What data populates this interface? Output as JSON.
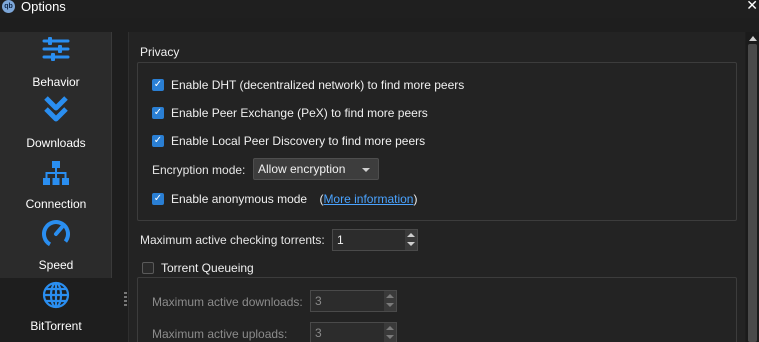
{
  "window": {
    "title": "Options",
    "app_icon_text": "qb"
  },
  "sidebar": {
    "items": [
      {
        "label": "Behavior",
        "icon": "sliders-icon"
      },
      {
        "label": "Downloads",
        "icon": "double-chevron-down-icon"
      },
      {
        "label": "Connection",
        "icon": "network-icon"
      },
      {
        "label": "Speed",
        "icon": "speedometer-icon"
      },
      {
        "label": "BitTorrent",
        "icon": "globe-icon",
        "selected": true
      }
    ]
  },
  "privacy": {
    "title": "Privacy",
    "dht_label": "Enable DHT (decentralized network) to find more peers",
    "dht_checked": true,
    "pex_label": "Enable Peer Exchange (PeX) to find more peers",
    "pex_checked": true,
    "lsd_label": "Enable Local Peer Discovery to find more peers",
    "lsd_checked": true,
    "encryption_label": "Encryption mode:",
    "encryption_value": "Allow encryption",
    "anonymous_label": "Enable anonymous mode",
    "anonymous_checked": true,
    "more_info_open": "(",
    "more_info_link": "More information",
    "more_info_close": ")"
  },
  "checking": {
    "label": "Maximum active checking torrents:",
    "value": "1"
  },
  "queueing": {
    "label": "Torrent Queueing",
    "checked": false,
    "max_downloads_label": "Maximum active downloads:",
    "max_downloads_value": "3",
    "max_uploads_label": "Maximum active uploads:",
    "max_uploads_value": "3"
  },
  "colors": {
    "accent": "#2a7fd4",
    "icon_blue": "#2a8ef0",
    "link": "#4aa3ff",
    "background": "#1e1e1e"
  }
}
